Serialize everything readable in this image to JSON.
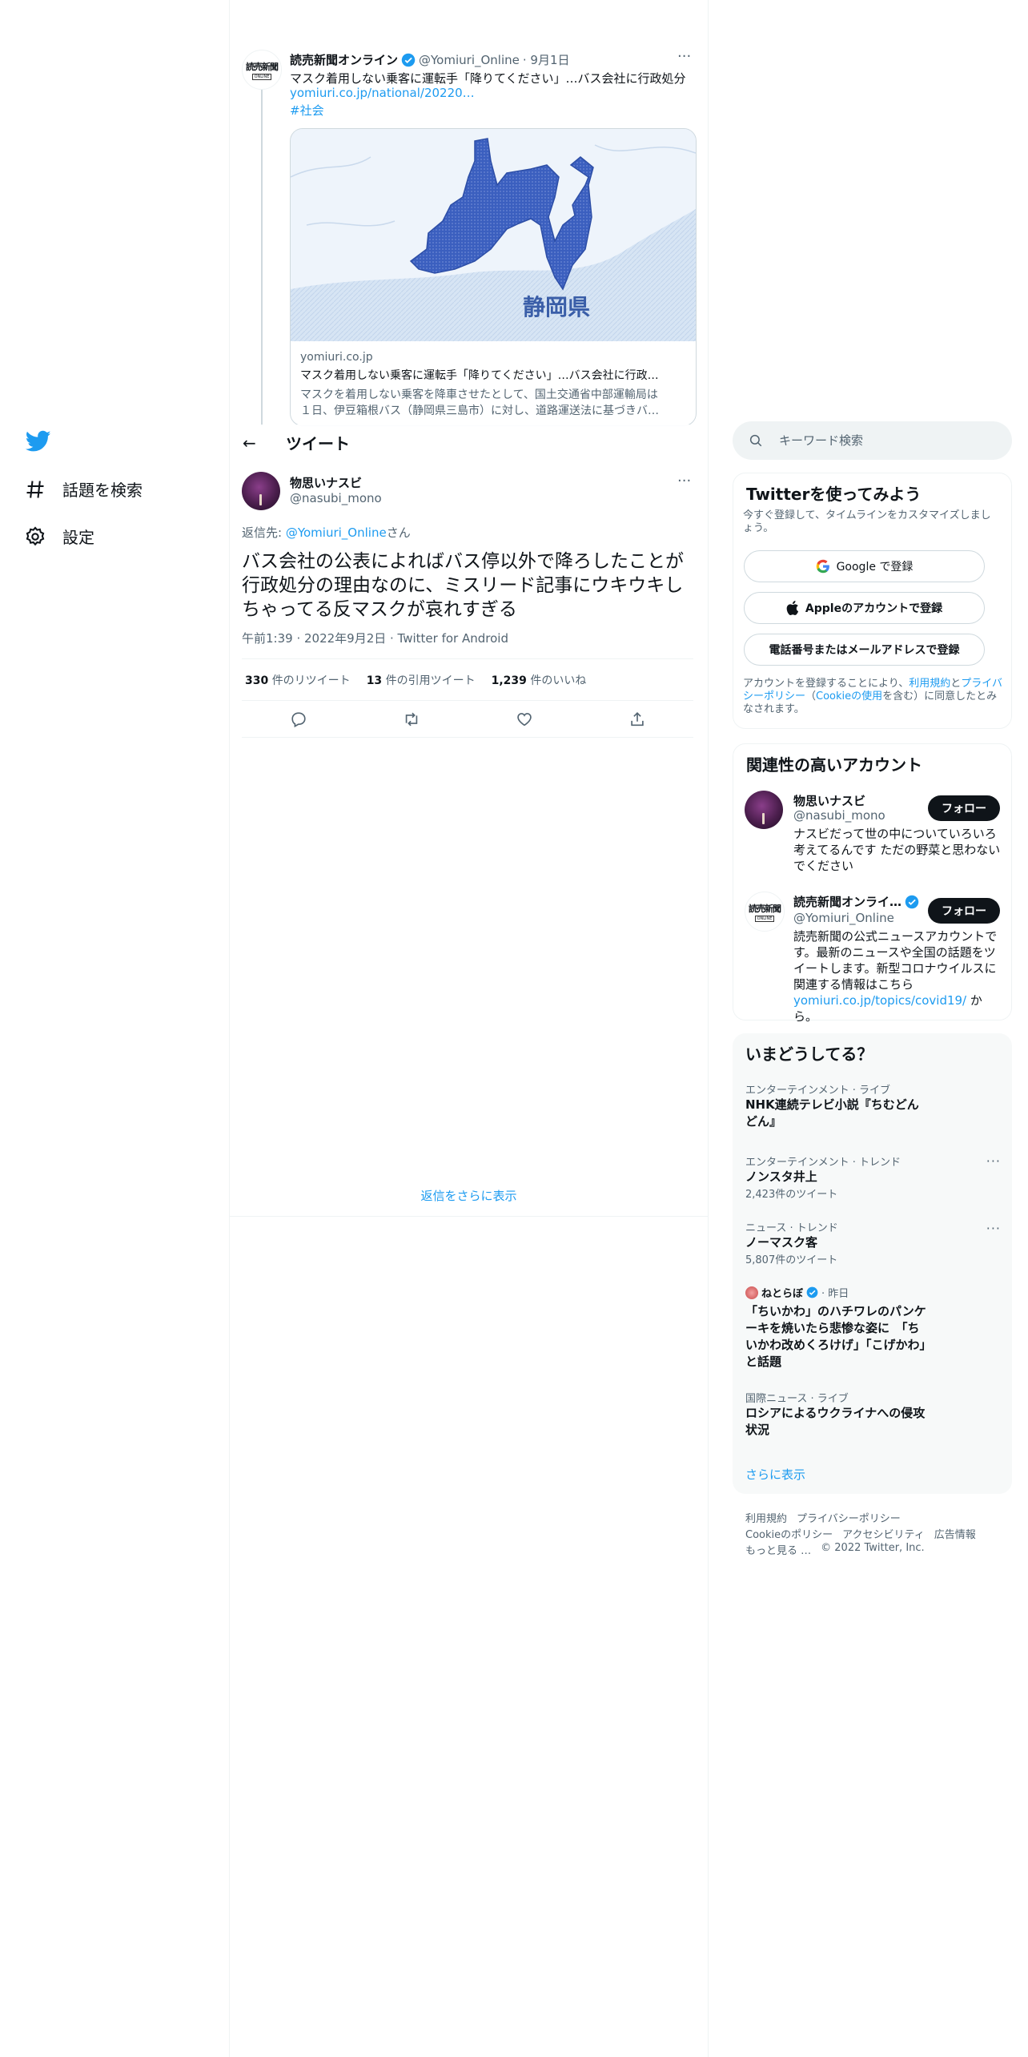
{
  "nav": {
    "items": [
      {
        "label": "話題を検索",
        "icon": "hashtag-icon"
      },
      {
        "label": "設定",
        "icon": "gear-icon"
      }
    ]
  },
  "parent_tweet": {
    "name": "読売新聞オンライン",
    "handle": "@Yomiuri_Online",
    "date": "· 9月1日",
    "logo_text": "読売新聞",
    "logo_sub": "ONLINE",
    "text": "マスク着用しない乗客に運転手「降りてください」…バス会社に行政処分",
    "link": "yomiuri.co.jp/national/20220…",
    "hashtag": "#社会",
    "card": {
      "map_label": "静岡県",
      "domain": "yomiuri.co.jp",
      "title": "マスク着用しない乗客に運転手「降りてください」…バス会社に行政…",
      "desc_line1": "マスクを着用しない乗客を降車させたとして、国土交通省中部運輸局は",
      "desc_line2": "１日、伊豆箱根バス（静岡県三島市）に対し、道路運送法に基づきバ…"
    }
  },
  "header": {
    "back": "←",
    "title": "ツイート"
  },
  "main_tweet": {
    "name": "物思いナスビ",
    "handle": "@nasubi_mono",
    "reply_prefix": "返信先: ",
    "reply_to": "@Yomiuri_Online",
    "reply_suffix": "さん",
    "text": "バス会社の公表によればバス停以外で降ろしたことが行政処分の理由なのに、ミスリード記事にウキウキしちゃってる反マスクが哀れすぎる",
    "meta": "午前1:39 · 2022年9月2日 · Twitter for Android",
    "stats": {
      "retweets": "330",
      "retweets_label": "件のリツイート",
      "quotes": "13",
      "quotes_label": "件の引用ツイート",
      "likes": "1,239",
      "likes_label": "件のいいね"
    }
  },
  "show_more_replies": "返信をさらに表示",
  "search": {
    "placeholder": "キーワード検索"
  },
  "signup": {
    "title": "Twitterを使ってみよう",
    "subtitle": "今すぐ登録して、タイムラインをカスタマイズしましょう。",
    "google": "Google で登録",
    "apple": "Appleのアカウントで登録",
    "phone": "電話番号またはメールアドレスで登録",
    "terms_1": "アカウントを登録することにより、",
    "terms_link1": "利用規約",
    "terms_2": "と",
    "terms_link2": "プライバシーポリシー",
    "terms_3": "（",
    "terms_link3": "Cookieの使用",
    "terms_4": "を含む）に同意したとみなされます。"
  },
  "related": {
    "title": "関連性の高いアカウント",
    "accounts": [
      {
        "name": "物思いナスビ",
        "handle": "@nasubi_mono",
        "follow": "フォロー",
        "bio": "ナスビだって世の中についていろいろ考えてるんです ただの野菜と思わないでください"
      },
      {
        "name": "読売新聞オンライ…",
        "handle": "@Yomiuri_Online",
        "follow": "フォロー",
        "bio": "読売新聞の公式ニュースアカウントです。最新のニュースや全国の話題をツイートします。新型コロナウイルスに関連する情報はこちら",
        "bio_link": "yomiuri.co.jp/topics/covid19/",
        "bio_end": " から。"
      }
    ]
  },
  "trends": {
    "title": "いまどうしてる？",
    "items": [
      {
        "category": "エンターテインメント · ライブ",
        "name": "NHK連続テレビ小説『ちむどんどん』"
      },
      {
        "category": "エンターテインメント · トレンド",
        "name": "ノンスタ井上",
        "count": "2,423件のツイート"
      },
      {
        "category": "ニュース · トレンド",
        "name": "ノーマスク客",
        "count": "5,807件のツイート"
      },
      {
        "source": "ねとらぼ",
        "time": "· 昨日",
        "name": "「ちいかわ」のハチワレのパンケーキを焼いたら悲惨な姿に　「ちいかわ改めくろけげ」「こげかわ」と話題"
      },
      {
        "category": "国際ニュース · ライブ",
        "name": "ロシアによるウクライナへの侵攻状況"
      }
    ],
    "show_more": "さらに表示"
  },
  "footer": {
    "line1": [
      "利用規約",
      "プライバシーポリシー"
    ],
    "line2": [
      "Cookieのポリシー",
      "アクセシビリティ",
      "広告情報"
    ],
    "more": "もっと見る …",
    "copyright": "© 2022 Twitter, Inc."
  },
  "colors": {
    "accent": "#1d9bf0",
    "text": "#0f1419",
    "muted": "#536471",
    "border": "#eff3f4"
  }
}
